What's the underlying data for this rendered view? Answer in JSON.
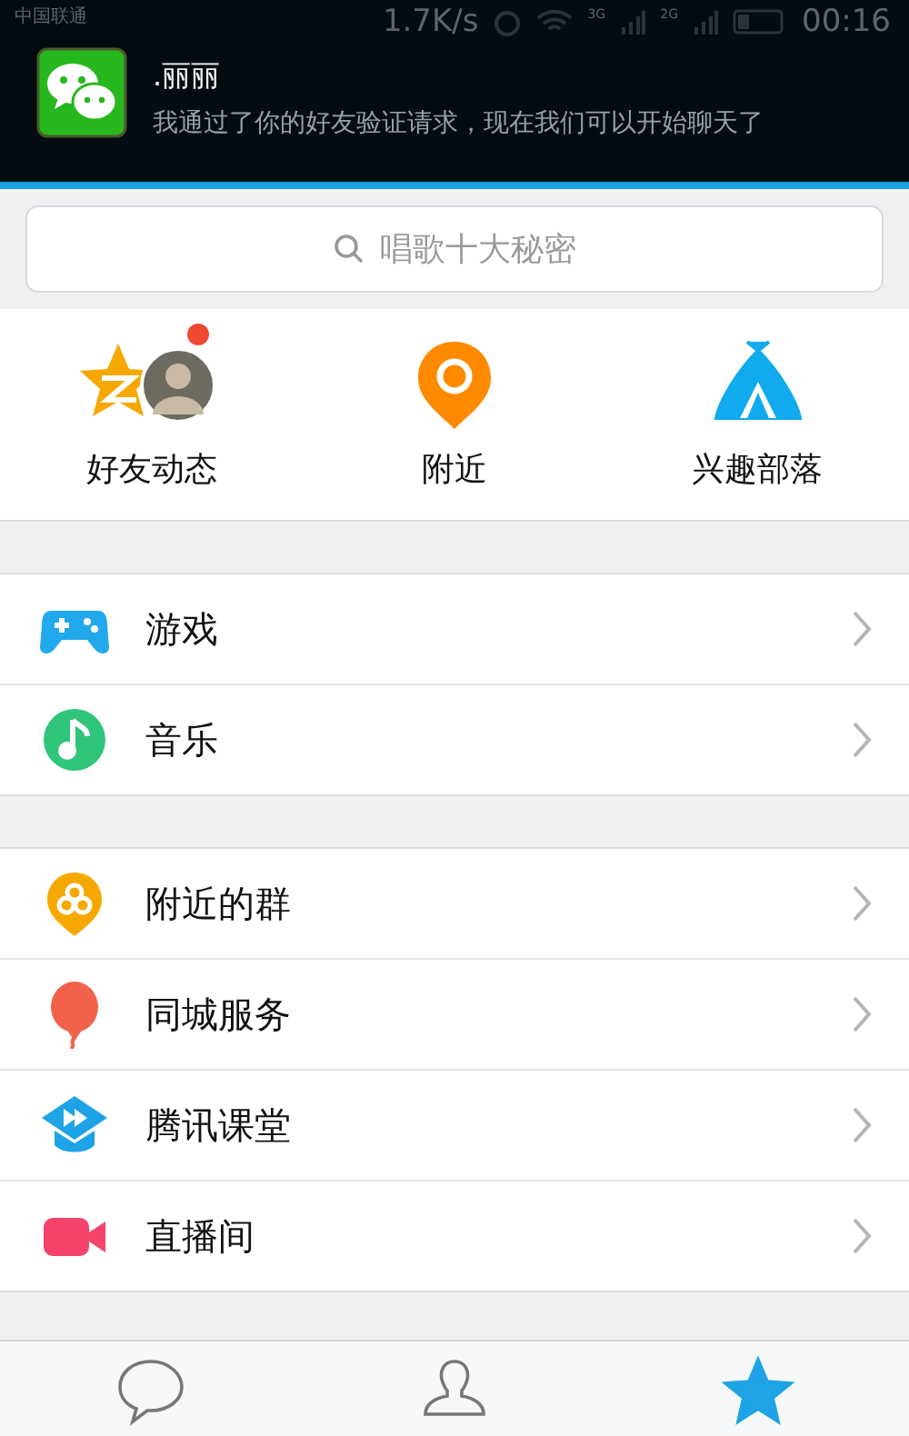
{
  "status_bar": {
    "carrier": "中国联通",
    "speed": "1.7K/s",
    "network_labels": [
      "3G",
      "2G"
    ],
    "time": "00:16"
  },
  "notification": {
    "title": ".丽丽",
    "message": "我通过了你的好友验证请求，现在我们可以开始聊天了"
  },
  "search": {
    "placeholder": "唱歌十大秘密"
  },
  "shortcuts": [
    {
      "label": "好友动态",
      "kind": "feed",
      "badge": true
    },
    {
      "label": "附近",
      "kind": "nearby",
      "badge": false
    },
    {
      "label": "兴趣部落",
      "kind": "tribe",
      "badge": false
    }
  ],
  "menu_groups": [
    [
      {
        "label": "游戏",
        "kind": "game"
      },
      {
        "label": "音乐",
        "kind": "music"
      }
    ],
    [
      {
        "label": "附近的群",
        "kind": "group"
      },
      {
        "label": "同城服务",
        "kind": "balloon"
      },
      {
        "label": "腾讯课堂",
        "kind": "class"
      },
      {
        "label": "直播间",
        "kind": "live"
      }
    ]
  ],
  "tab_bar": [
    {
      "kind": "chat",
      "selected": false
    },
    {
      "kind": "contacts",
      "selected": false
    },
    {
      "kind": "star",
      "selected": true
    }
  ]
}
